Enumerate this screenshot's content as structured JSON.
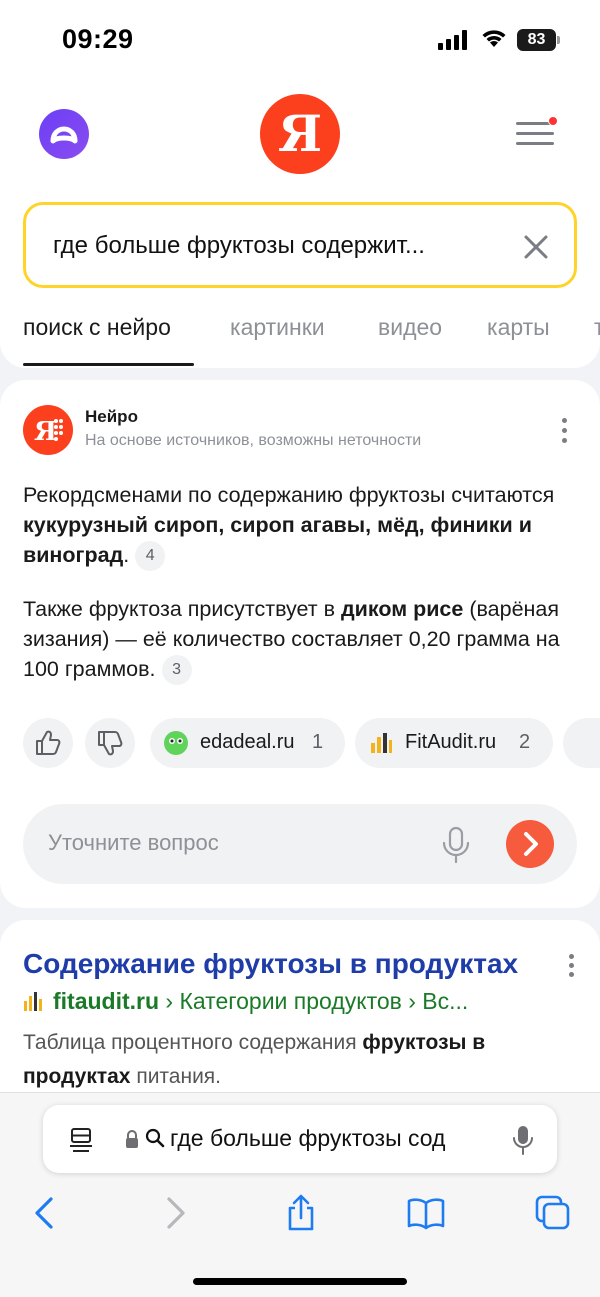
{
  "status_bar": {
    "time": "09:29",
    "battery": "83"
  },
  "header": {
    "logo_letter": "Я",
    "assistant_icon": "alice-icon",
    "menu_icon": "hamburger-icon"
  },
  "search": {
    "query": "где больше фруктозы содержит..."
  },
  "tabs": [
    {
      "label": "поиск с нейро",
      "active": true
    },
    {
      "label": "картинки",
      "active": false
    },
    {
      "label": "видео",
      "active": false
    },
    {
      "label": "карты",
      "active": false
    },
    {
      "label": "т",
      "active": false
    }
  ],
  "neuro": {
    "title": "Нейро",
    "subtitle": "На основе источников, возможны неточности",
    "answer1": {
      "text_before": "Рекордсменами по содержанию фруктозы считаются ",
      "bold": "кукурузный сироп, сироп агавы, мёд, финики и виноград",
      "text_after": ".",
      "ref": "4"
    },
    "answer2": {
      "text_before": "Также фруктоза присутствует в ",
      "bold": "диком рисе",
      "text_after": " (варёная зизания) — её количество составляет 0,20 грамма на 100 граммов.",
      "ref": "3"
    },
    "sources": [
      {
        "label": "edadeal.ru",
        "num": "1",
        "icon": "edadeal-icon"
      },
      {
        "label": "FitAudit.ru",
        "num": "2",
        "icon": "fitaudit-icon"
      }
    ],
    "ask_placeholder": "Уточните вопрос"
  },
  "result": {
    "title": "Содержание фруктозы в продуктах",
    "site": "fitaudit.ru",
    "path": " › Категории продуктов › Вс...",
    "snippet_before": "Таблица процентного содержания ",
    "snippet_bold": "фруктозы в продуктах",
    "snippet_after": " питания."
  },
  "browser": {
    "address": "где больше фруктозы сод"
  },
  "colors": {
    "yandex_red": "#fc3f1d",
    "alice_purple": "#7a43f4",
    "search_border": "#fed42b",
    "result_link": "#1f3da8",
    "result_url": "#1b7a28",
    "send_button": "#f55b3c",
    "ios_blue": "#1e7cf2"
  }
}
